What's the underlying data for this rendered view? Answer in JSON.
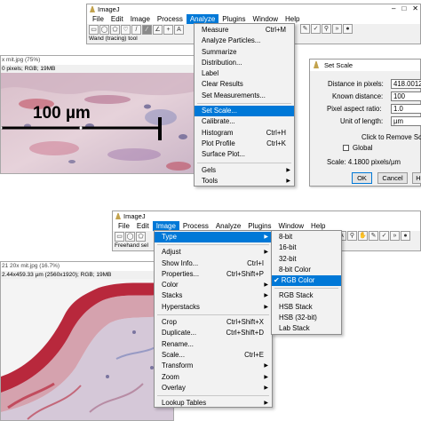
{
  "top": {
    "title": "ImageJ",
    "window_controls": [
      "–",
      "□",
      "✕"
    ],
    "menus": [
      "File",
      "Edit",
      "Image",
      "Process",
      "Analyze",
      "Plugins",
      "Window",
      "Help"
    ],
    "active_menu": "Analyze",
    "status": "Wand (tracing) tool",
    "image": {
      "title": "x mit.jpg (75%)",
      "info": "0 pixels; RGB; 19MB",
      "scale_label": "100 µm"
    },
    "analyze_menu": [
      {
        "label": "Measure",
        "shortcut": "Ctrl+M"
      },
      {
        "label": "Analyze Particles..."
      },
      {
        "label": "Summarize"
      },
      {
        "label": "Distribution..."
      },
      {
        "label": "Label"
      },
      {
        "label": "Clear Results"
      },
      {
        "label": "Set Measurements..."
      },
      {
        "sep": true
      },
      {
        "label": "Set Scale...",
        "highlight": true
      },
      {
        "label": "Calibrate..."
      },
      {
        "label": "Histogram",
        "shortcut": "Ctrl+H"
      },
      {
        "label": "Plot Profile",
        "shortcut": "Ctrl+K"
      },
      {
        "label": "Surface Plot..."
      },
      {
        "sep": true
      },
      {
        "label": "Gels",
        "submenu": true
      },
      {
        "label": "Tools",
        "submenu": true
      }
    ]
  },
  "set_scale": {
    "title": "Set Scale",
    "distance_label": "Distance in pixels:",
    "distance_value": "418.0012",
    "known_label": "Known distance:",
    "known_value": "100",
    "aspect_label": "Pixel aspect ratio:",
    "aspect_value": "1.0",
    "unit_label": "Unit of length:",
    "unit_value": "µm",
    "remove_button": "Click to Remove Sc",
    "global_label": "Global",
    "scale_text": "Scale: 4.1800 pixels/µm",
    "ok": "OK",
    "cancel": "Cancel",
    "help": "H"
  },
  "bottom": {
    "title": "ImageJ",
    "menus": [
      "File",
      "Edit",
      "Image",
      "Process",
      "Analyze",
      "Plugins",
      "Window",
      "Help"
    ],
    "active_menu": "Image",
    "status": "Freehand sel",
    "image": {
      "title": "21 20x mit.jpg (16.7%)",
      "info": "2.44x459.33 µm (2560x1920); RGB; 19MB"
    },
    "image_menu": [
      {
        "label": "Type",
        "submenu": true,
        "highlight": true
      },
      {
        "sep": true
      },
      {
        "label": "Adjust",
        "submenu": true
      },
      {
        "label": "Show Info...",
        "shortcut": "Ctrl+I"
      },
      {
        "label": "Properties...",
        "shortcut": "Ctrl+Shift+P"
      },
      {
        "label": "Color",
        "submenu": true
      },
      {
        "label": "Stacks",
        "submenu": true
      },
      {
        "label": "Hyperstacks",
        "submenu": true
      },
      {
        "sep": true
      },
      {
        "label": "Crop",
        "shortcut": "Ctrl+Shift+X"
      },
      {
        "label": "Duplicate...",
        "shortcut": "Ctrl+Shift+D"
      },
      {
        "label": "Rename..."
      },
      {
        "label": "Scale...",
        "shortcut": "Ctrl+E"
      },
      {
        "label": "Transform",
        "submenu": true
      },
      {
        "label": "Zoom",
        "submenu": true
      },
      {
        "label": "Overlay",
        "submenu": true
      },
      {
        "sep": true
      },
      {
        "label": "Lookup Tables",
        "submenu": true
      }
    ],
    "type_menu": [
      {
        "label": "8-bit"
      },
      {
        "label": "16-bit"
      },
      {
        "label": "32-bit"
      },
      {
        "label": "8-bit Color"
      },
      {
        "label": "RGB Color",
        "checked": true,
        "highlight": true
      },
      {
        "sep": true
      },
      {
        "label": "RGB Stack"
      },
      {
        "label": "HSB Stack"
      },
      {
        "label": "HSB (32-bit)"
      },
      {
        "label": "Lab Stack"
      }
    ]
  },
  "colors": {
    "highlight": "#0078d7",
    "tissue_bg": "#e8dbe0",
    "stain_red": "#b8283c",
    "stain_blue": "#5a6bb0"
  },
  "tool_icons": [
    "rectangle-icon",
    "oval-icon",
    "polygon-icon",
    "freehand-icon",
    "line-icon",
    "angle-icon",
    "point-icon",
    "wand-icon",
    "text-icon",
    "zoom-icon",
    "hand-icon",
    "eyedropper-icon",
    "brush-icon",
    "more-tools-icon"
  ]
}
